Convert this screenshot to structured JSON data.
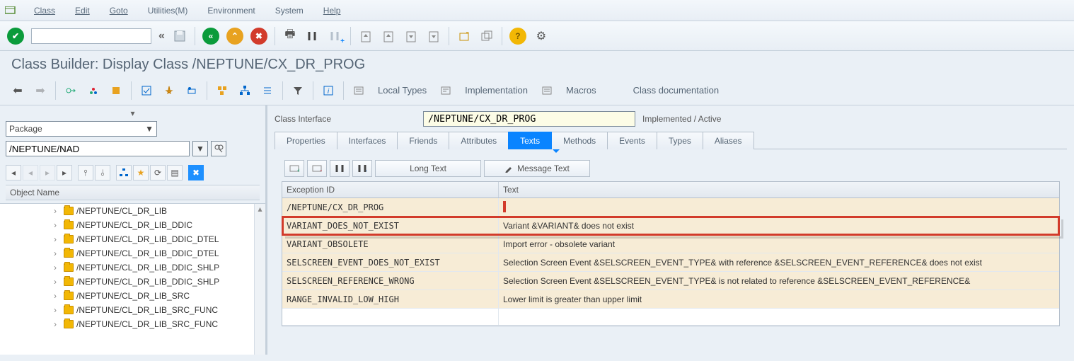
{
  "menu": {
    "class": "Class",
    "edit": "Edit",
    "goto": "Goto",
    "utilities": "Utilities(M)",
    "environment": "Environment",
    "system": "System",
    "help": "Help"
  },
  "toolbar1": {
    "combo_value": ""
  },
  "page_title": "Class Builder: Display Class /NEPTUNE/CX_DR_PROG",
  "toolbar2": {
    "local_types": "Local Types",
    "implementation": "Implementation",
    "macros": "Macros",
    "class_doc": "Class documentation"
  },
  "left": {
    "package_label": "Package",
    "package_value": "/NEPTUNE/NAD",
    "object_name_header": "Object Name",
    "tree": [
      "/NEPTUNE/CL_DR_LIB",
      "/NEPTUNE/CL_DR_LIB_DDIC",
      "/NEPTUNE/CL_DR_LIB_DDIC_DTEL",
      "/NEPTUNE/CL_DR_LIB_DDIC_DTEL",
      "/NEPTUNE/CL_DR_LIB_DDIC_SHLP",
      "/NEPTUNE/CL_DR_LIB_DDIC_SHLP",
      "/NEPTUNE/CL_DR_LIB_SRC",
      "/NEPTUNE/CL_DR_LIB_SRC_FUNC",
      "/NEPTUNE/CL_DR_LIB_SRC_FUNC"
    ]
  },
  "class_interface": {
    "label": "Class Interface",
    "value": "/NEPTUNE/CX_DR_PROG",
    "status": "Implemented / Active"
  },
  "tabs": {
    "properties": "Properties",
    "interfaces": "Interfaces",
    "friends": "Friends",
    "attributes": "Attributes",
    "texts": "Texts",
    "methods": "Methods",
    "events": "Events",
    "types": "Types",
    "aliases": "Aliases"
  },
  "grid_toolbar": {
    "long_text": "Long Text",
    "message_text": "Message Text"
  },
  "grid": {
    "head_exception": "Exception ID",
    "head_text": "Text",
    "rows": [
      {
        "id": "/NEPTUNE/CX_DR_PROG",
        "text": ""
      },
      {
        "id": "VARIANT_DOES_NOT_EXIST",
        "text": "Variant &VARIANT& does not exist"
      },
      {
        "id": "VARIANT_OBSOLETE",
        "text": "Import error - obsolete variant"
      },
      {
        "id": "SELSCREEN_EVENT_DOES_NOT_EXIST",
        "text": "Selection Screen Event &SELSCREEN_EVENT_TYPE& with reference &SELSCREEN_EVENT_REFERENCE& does not exist"
      },
      {
        "id": "SELSCREEN_REFERENCE_WRONG",
        "text": "Selection Screen Event &SELSCREEN_EVENT_TYPE& is not related to reference &SELSCREEN_EVENT_REFERENCE&"
      },
      {
        "id": "RANGE_INVALID_LOW_HIGH",
        "text": "Lower limit is greater than upper limit"
      }
    ]
  }
}
